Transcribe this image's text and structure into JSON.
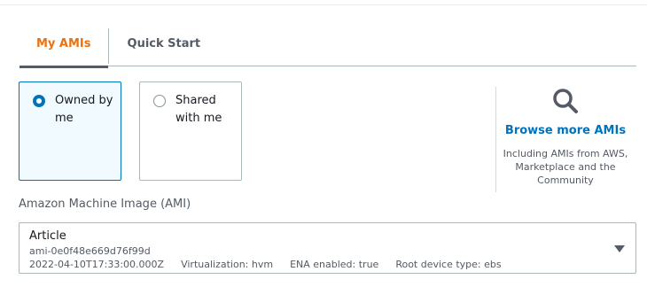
{
  "tabs": [
    {
      "label": "My AMIs",
      "active": true
    },
    {
      "label": "Quick Start",
      "active": false
    }
  ],
  "options": [
    {
      "label": "Owned by me",
      "checked": true
    },
    {
      "label": "Shared with me",
      "checked": false
    }
  ],
  "browse": {
    "icon": "search-icon",
    "link": "Browse more AMIs",
    "description": "Including AMIs from AWS, Marketplace and the Community"
  },
  "ami": {
    "field_label": "Amazon Machine Image (AMI)",
    "name": "Article",
    "id": "ami-0e0f48e669d76f99d",
    "created": "2022-04-10T17:33:00.000Z",
    "virtualization": "Virtualization: hvm",
    "ena": "ENA enabled: true",
    "root_device": "Root device type: ebs"
  },
  "colors": {
    "accent": "#ec7211",
    "link": "#0073bb",
    "selected_bg": "#f1faff"
  }
}
